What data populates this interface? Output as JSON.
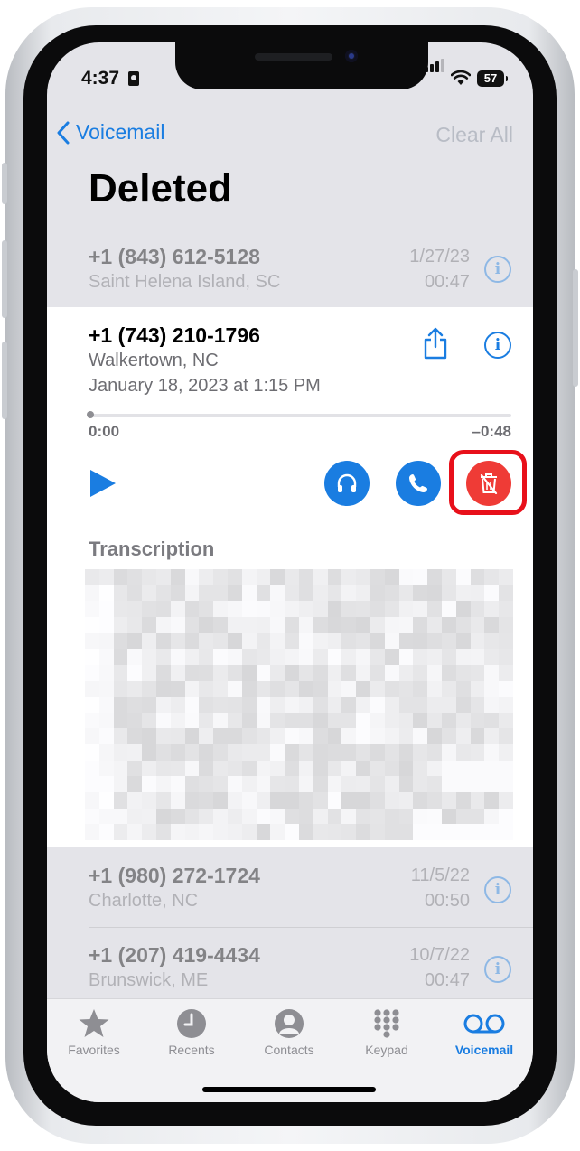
{
  "status": {
    "time": "4:37",
    "battery": "57"
  },
  "nav": {
    "back_label": "Voicemail",
    "clear_all": "Clear All"
  },
  "page_title": "Deleted",
  "voicemails_top": [
    {
      "number": "+1 (843) 612-5128",
      "location": "Saint Helena Island, SC",
      "date": "1/27/23",
      "duration": "00:47"
    }
  ],
  "expanded": {
    "number": "+1 (743) 210-1796",
    "location": "Walkertown, NC",
    "datetime": "January 18, 2023 at 1:15 PM",
    "time_elapsed": "0:00",
    "time_remaining": "–0:48",
    "progress": 0.0,
    "transcription_label": "Transcription"
  },
  "voicemails_bottom": [
    {
      "number": "+1 (980) 272-1724",
      "location": "Charlotte, NC",
      "date": "11/5/22",
      "duration": "00:50"
    },
    {
      "number": "+1 (207) 419-4434",
      "location": "Brunswick, ME",
      "date": "10/7/22",
      "duration": "00:47"
    }
  ],
  "tabs": [
    {
      "label": "Favorites",
      "icon": "star-icon"
    },
    {
      "label": "Recents",
      "icon": "clock-icon"
    },
    {
      "label": "Contacts",
      "icon": "person-icon"
    },
    {
      "label": "Keypad",
      "icon": "keypad-icon"
    },
    {
      "label": "Voicemail",
      "icon": "voicemail-icon",
      "active": true
    }
  ],
  "colors": {
    "accent": "#1a7de1",
    "delete": "#ef3b36",
    "highlight": "#e8101a"
  }
}
